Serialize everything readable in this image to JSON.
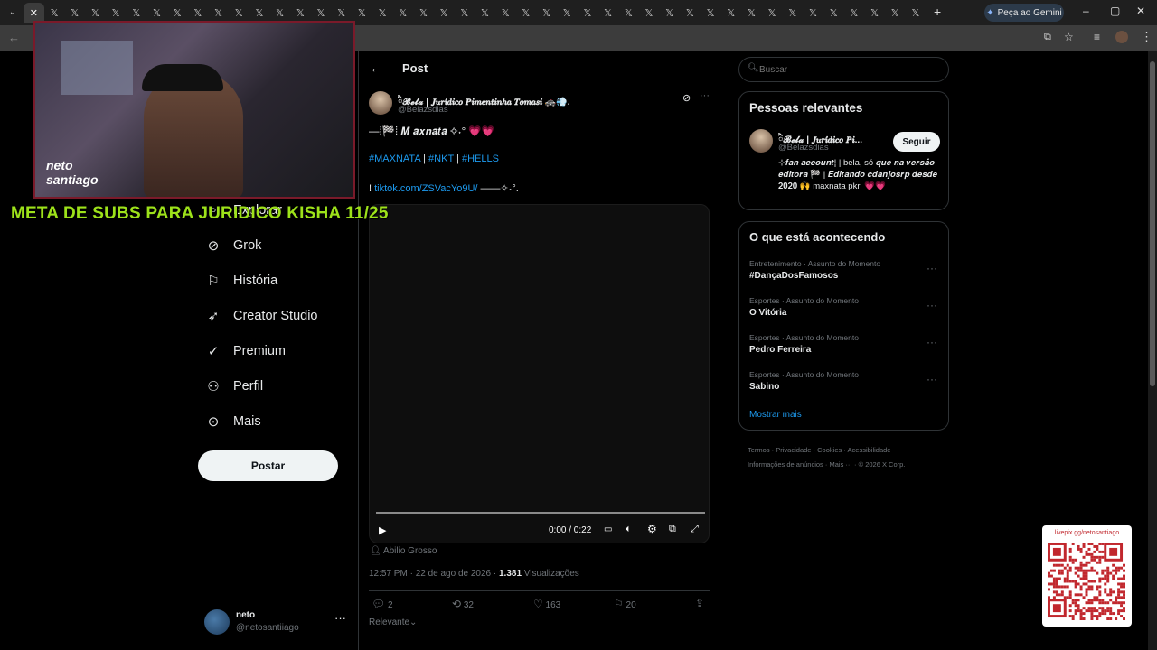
{
  "browser": {
    "tabs_count": 44,
    "gemini_label": "Peça ao Gemini",
    "active_tab_icon": "close-icon"
  },
  "colors": {
    "accent": "#1d9bf0",
    "overlay_text": "#9de21a",
    "like": "#f91880"
  },
  "stream": {
    "overlay": "META DE SUBS PARA JURIDICO KISHA 11/25",
    "webcam_caption": "neto santiago",
    "qr_url": "livepix.gg/netosantiago"
  },
  "nav": {
    "items": [
      {
        "label": "Explorar",
        "icon": "search-icon"
      },
      {
        "label": "Grok",
        "icon": "grok-icon"
      },
      {
        "label": "História",
        "icon": "bookmark-icon"
      },
      {
        "label": "Creator Studio",
        "icon": "rocket-icon"
      },
      {
        "label": "Premium",
        "icon": "verified-icon"
      },
      {
        "label": "Perfil",
        "icon": "person-icon"
      },
      {
        "label": "Mais",
        "icon": "more-circle-icon"
      }
    ],
    "post_button": "Postar",
    "account": {
      "name": "neto",
      "handle": "@netosantiiago"
    }
  },
  "post": {
    "header": "Post",
    "author_name": "ི𝓑𝓮𝓵𝓪 | 𝑱𝒖𝒓𝒊́𝒅𝒊𝒄𝒐 𝑷𝒊𝒎𝒆𝒏𝒕𝒊𝒏𝒉𝒂 𝑻𝒐𝒎𝒂𝒔𝒊 🚓💨.",
    "author_handle": "@Belazsdias",
    "line1": "—⁞🏁⁞ 𝑴 𝒂𝒙𝒏𝒂𝒕𝒂 ✧˖° 💗💗",
    "hashtags": [
      "#MAXNATA",
      "#NKT",
      "#HELLS"
    ],
    "link_prefix": "! ",
    "link": "tiktok.com/ZSVacYo9U/",
    "link_suffix": " ——✧˖°.",
    "video_time": "0:00 / 0:22",
    "video_progress": 0,
    "audio": "Abilio Grosso",
    "timestamp": "12:57 PM · 22 de ago de 2026 · ",
    "views_count": "1.381",
    "views_label": " Visualizações",
    "replies": "2",
    "reposts": "32",
    "likes": "163",
    "bookmarks": "20",
    "sort_label": "Relevante"
  },
  "right": {
    "search_placeholder": "Buscar",
    "relevant": {
      "title": "Pessoas relevantes",
      "name": "ི𝓑𝓮𝓵𝓪 | 𝑱𝒖𝒓𝒊́𝒅𝒊𝒄𝒐 𝑷𝒊...",
      "handle": "@Belazsdias",
      "follow": "Seguir",
      "bio": "⊹𝒇𝒂𝒏 𝒂𝒄𝒄𝒐𝒖𝒏𝒕¦ | bela, só 𝒒𝒖𝒆 𝒏𝒂 𝒗𝒆𝒓𝒔𝒂̃𝒐 𝒆𝒅𝒊𝒕𝒐𝒓𝒂 🏁 | 𝑬𝒅𝒊𝒕𝒂𝒏𝒅𝒐 𝒄𝒅𝒂𝒏𝒋𝒐𝒔𝒓𝒑 𝒅𝒆𝒔𝒅𝒆 𝟐𝟎𝟐𝟎 🙌 maxnata pkrl 💗💗"
    },
    "trending": {
      "title": "O que está acontecendo",
      "items": [
        {
          "context": "Entretenimento · Assunto do Momento",
          "topic": "#DançaDosFamosos"
        },
        {
          "context": "Esportes · Assunto do Momento",
          "topic": "O Vitória"
        },
        {
          "context": "Esportes · Assunto do Momento",
          "topic": "Pedro Ferreira"
        },
        {
          "context": "Esportes · Assunto do Momento",
          "topic": "Sabino"
        }
      ],
      "show_more": "Mostrar mais"
    },
    "footer": {
      "line1": [
        "Termos",
        "Privacidade",
        "Cookies",
        "Acessibilidade"
      ],
      "line2": [
        "Informações de anúncios",
        "Mais ···",
        "© 2026 X Corp."
      ]
    }
  }
}
